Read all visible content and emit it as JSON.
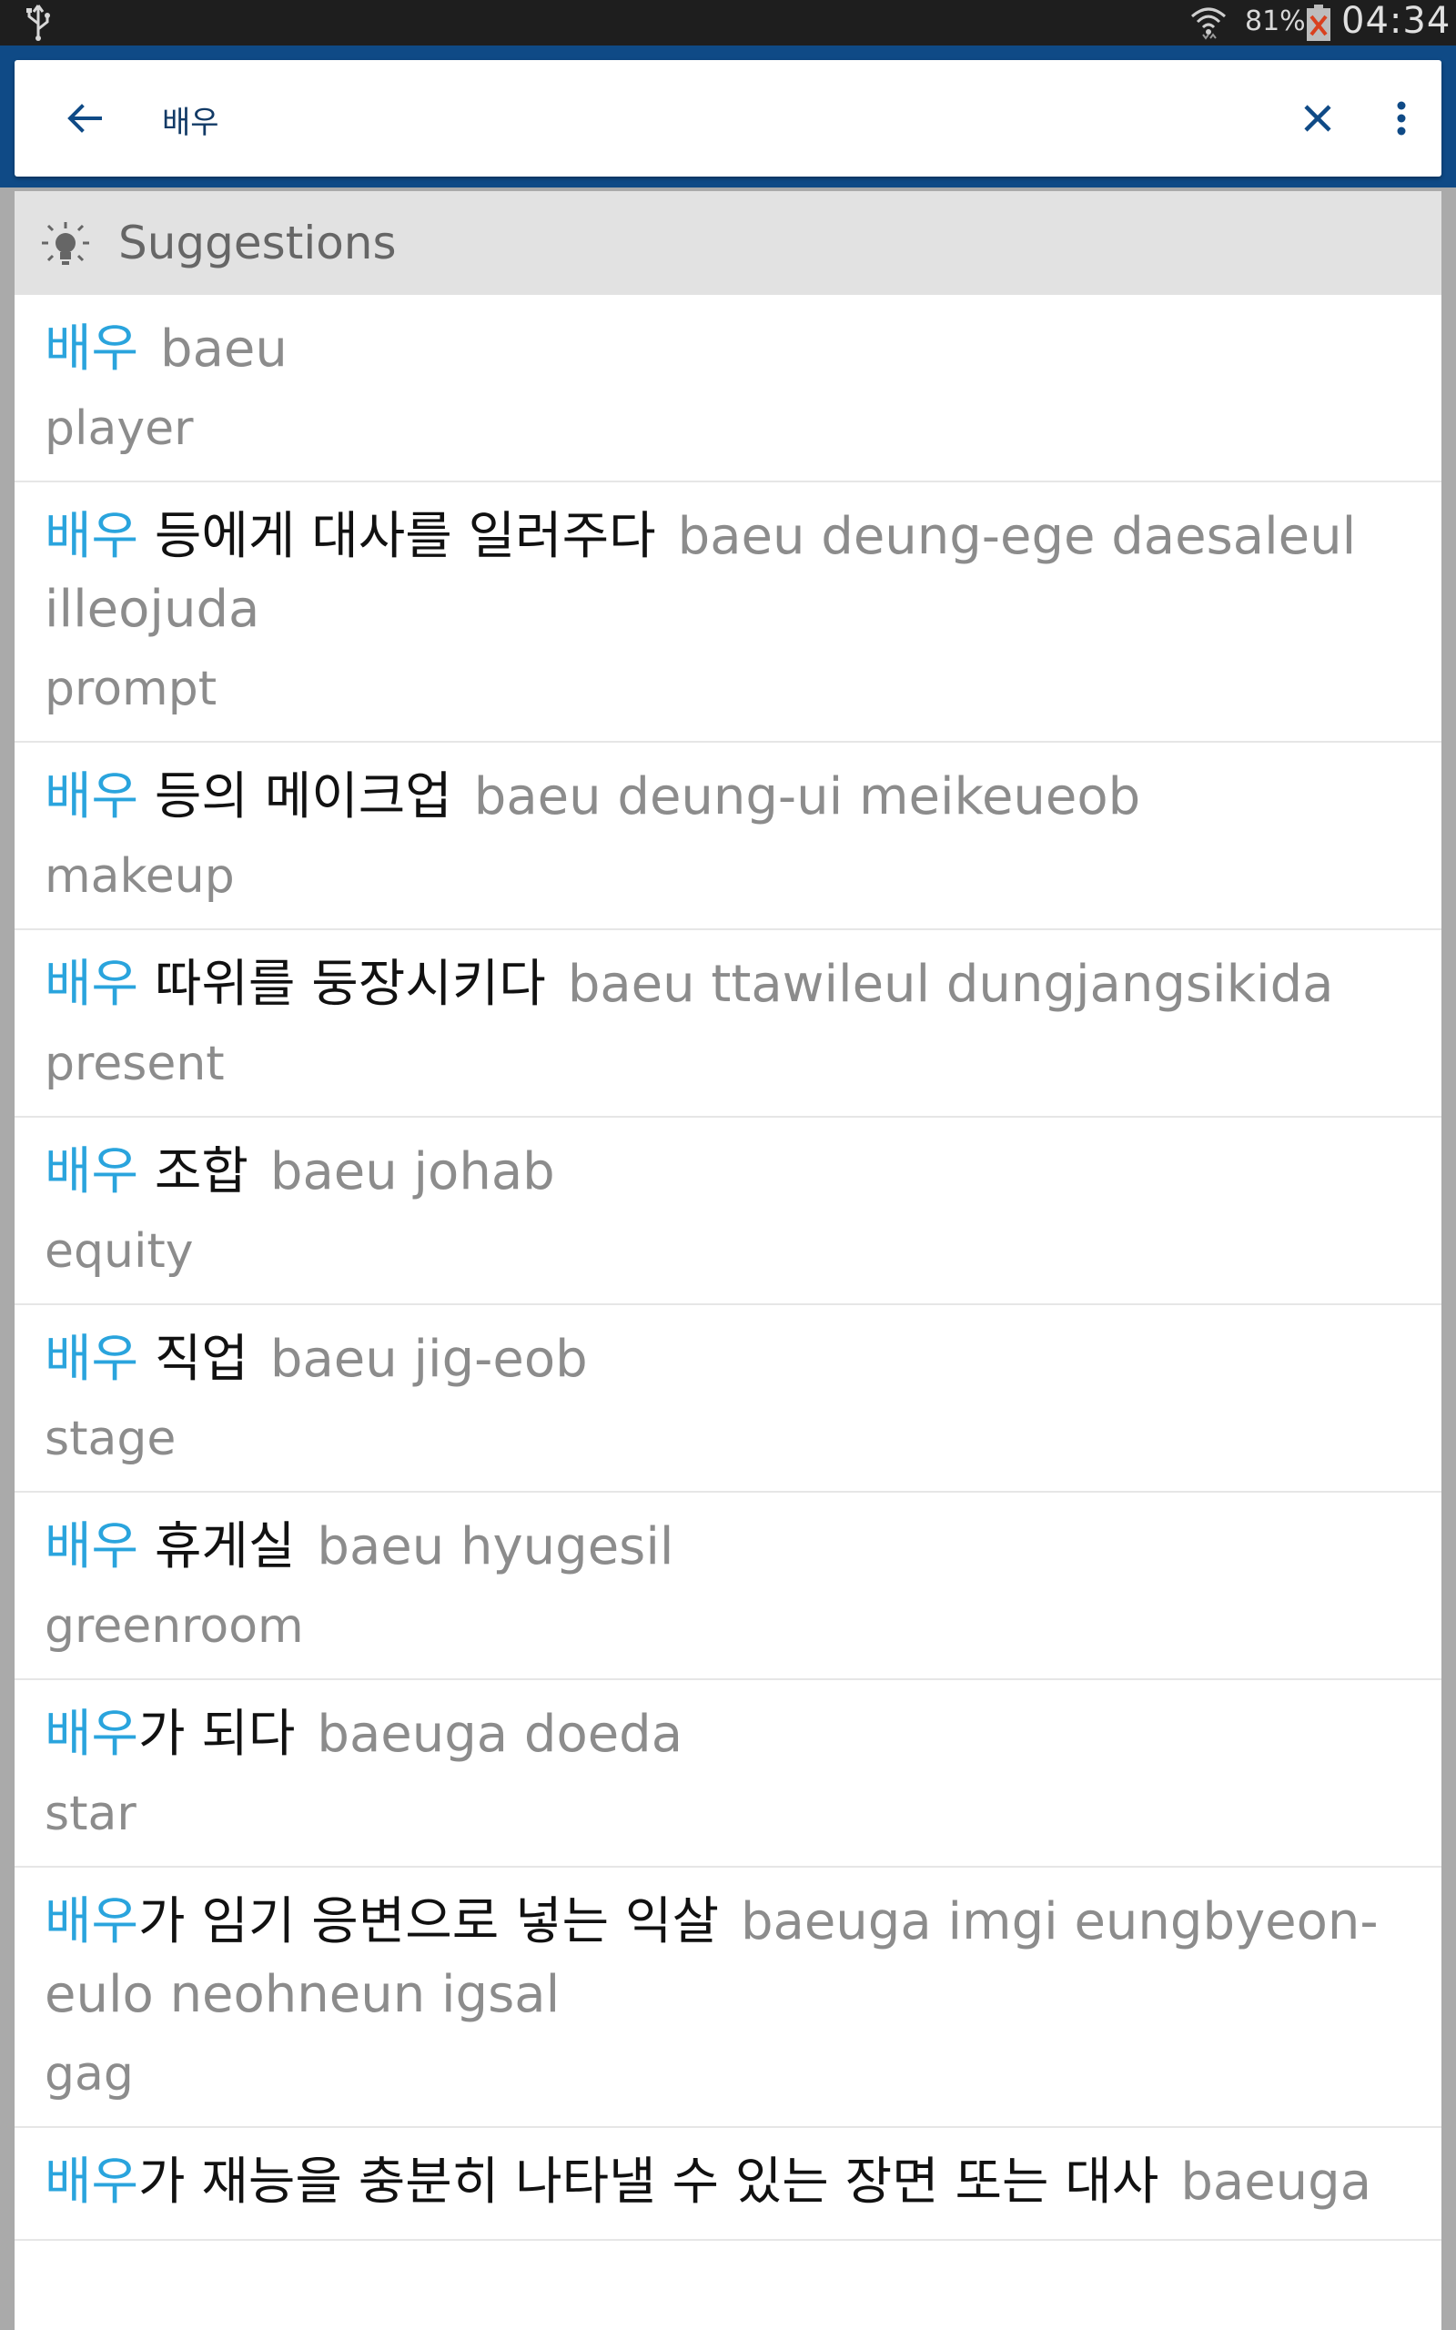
{
  "status_bar": {
    "battery_percent": "81%",
    "time": "04:34"
  },
  "search": {
    "query": "배우"
  },
  "suggestions_header": {
    "title": "Suggestions"
  },
  "colors": {
    "header_blue": "#0f4a86",
    "keyword_blue": "#2aa4dd",
    "muted_gray": "#8c8c8c"
  },
  "entries": [
    {
      "keyword": "배우",
      "rest": "",
      "romanization": "baeu",
      "translation": "player"
    },
    {
      "keyword": "배우",
      "rest": " 등에게 대사를 일러주다",
      "romanization": "baeu deung-ege daesaleul illeojuda",
      "translation": "prompt"
    },
    {
      "keyword": "배우",
      "rest": " 등의 메이크업",
      "romanization": "baeu deung-ui meikeueob",
      "translation": "makeup"
    },
    {
      "keyword": "배우",
      "rest": " 따위를 둥장시키다",
      "romanization": "baeu ttawileul dungjangsikida",
      "translation": "present"
    },
    {
      "keyword": "배우",
      "rest": " 조합",
      "romanization": "baeu johab",
      "translation": "equity"
    },
    {
      "keyword": "배우",
      "rest": " 직업",
      "romanization": "baeu jig-eob",
      "translation": "stage"
    },
    {
      "keyword": "배우",
      "rest": " 휴게실",
      "romanization": "baeu hyugesil",
      "translation": "greenroom"
    },
    {
      "keyword": "배우",
      "rest": "가 되다",
      "romanization": "baeuga doeda",
      "translation": "star"
    },
    {
      "keyword": "배우",
      "rest": "가 임기 응변으로 넣는 익살",
      "romanization": "baeuga imgi eungbyeon-eulo neohneun igsal",
      "translation": "gag"
    },
    {
      "keyword": "배우",
      "rest": "가 재능을 충분히 나타낼 수 있는 장면 또는 대사",
      "romanization": "baeuga",
      "translation": ""
    }
  ]
}
